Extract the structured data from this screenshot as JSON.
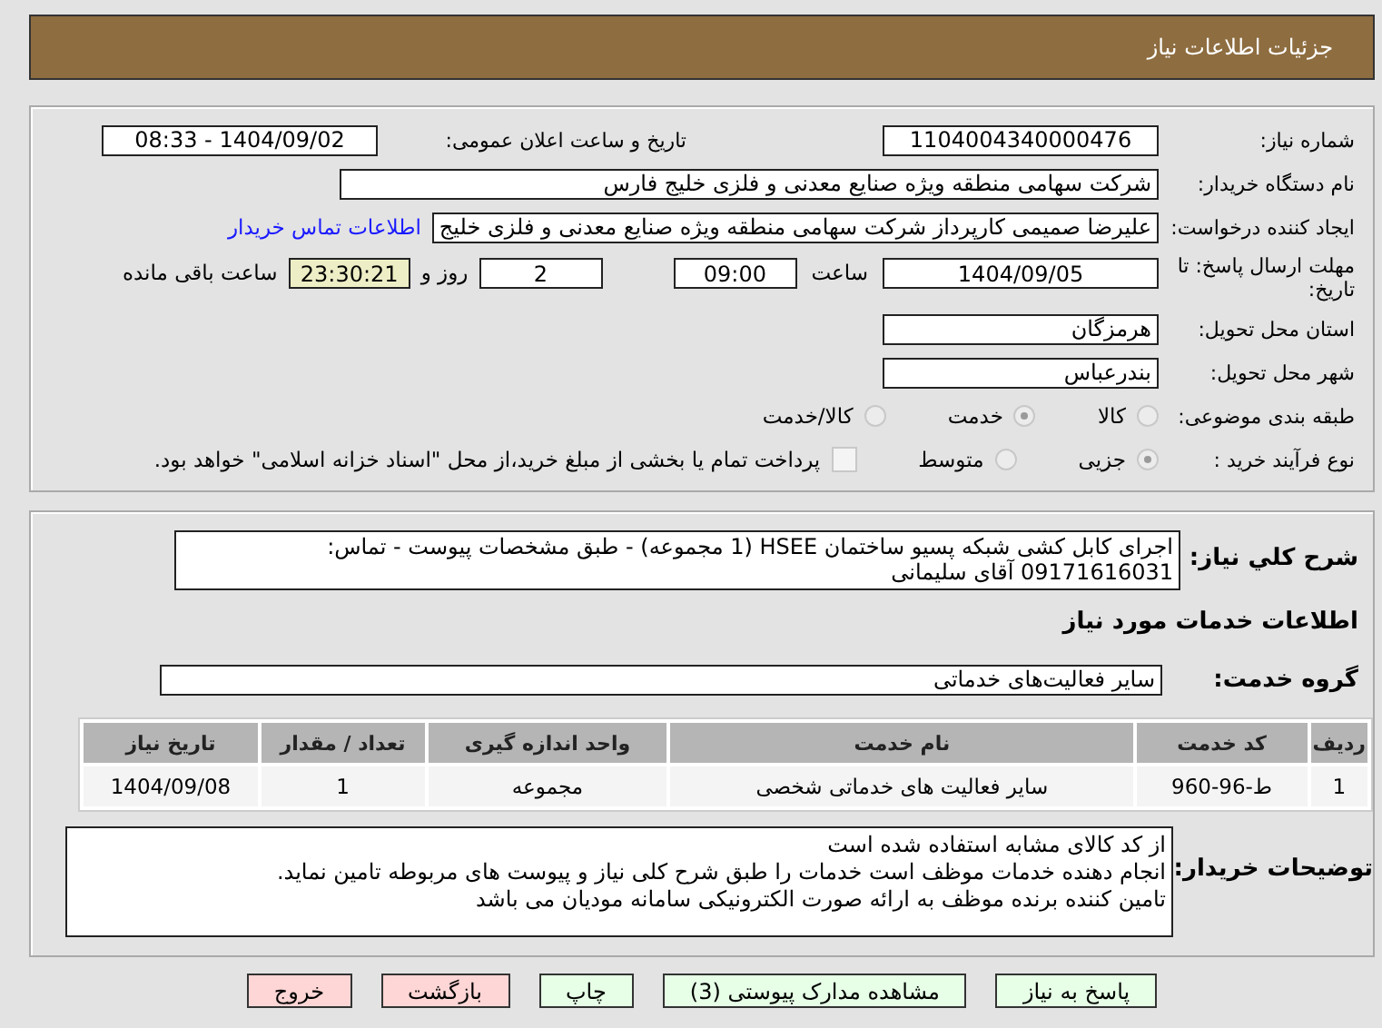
{
  "header": {
    "title": "جزئیات اطلاعات نیاز"
  },
  "fields": {
    "need_number": {
      "label": "شماره نیاز:",
      "value": "1104004340000476"
    },
    "announce": {
      "label": "تاریخ و ساعت اعلان عمومی:",
      "value": "1404/09/02 - 08:33"
    },
    "buyer": {
      "label": "نام دستگاه خریدار:",
      "value": "شرکت سهامی منطقه ویژه صنایع معدنی و فلزی خلیج فارس"
    },
    "creator": {
      "label": "ایجاد کننده درخواست:",
      "value": "علیرضا صمیمی کارپرداز شرکت سهامی منطقه ویژه صنایع معدنی و فلزی خلیج",
      "link": "اطلاعات تماس خریدار"
    },
    "deadline": {
      "label": "مهلت ارسال پاسخ: تا تاریخ:",
      "date": "1404/09/05",
      "time_label": "ساعت",
      "time": "09:00",
      "days": "2",
      "days_label": "روز و",
      "remaining": "23:30:21",
      "remaining_label": "ساعت باقی مانده"
    },
    "province": {
      "label": "استان محل تحویل:",
      "value": "هرمزگان"
    },
    "city": {
      "label": "شهر محل تحویل:",
      "value": "بندرعباس"
    },
    "category": {
      "label": "طبقه بندی موضوعی:",
      "options": [
        {
          "label": "کالا",
          "selected": false
        },
        {
          "label": "خدمت",
          "selected": true
        },
        {
          "label": "کالا/خدمت",
          "selected": false
        }
      ]
    },
    "process": {
      "label": "نوع فرآیند خرید :",
      "options": [
        {
          "label": "جزیی",
          "selected": true
        },
        {
          "label": "متوسط",
          "selected": false
        }
      ],
      "payment": {
        "checked": false,
        "label": "پرداخت تمام یا بخشی از مبلغ خرید،از محل \"اسناد خزانه اسلامی\" خواهد بود."
      }
    }
  },
  "description": {
    "label": "شرح کلي نياز:",
    "value": "اجرای کابل کشی شبکه پسیو ساختمان HSEE (1 مجموعه) - طبق مشخصات پیوست - تماس: 09171616031 آقای سلیمانی"
  },
  "services_heading": "اطلاعات خدمات مورد نیاز",
  "service_group": {
    "label": "گروه خدمت:",
    "value": "سایر فعالیت‌های خدماتی"
  },
  "table": {
    "columns": [
      "ردیف",
      "کد خدمت",
      "نام خدمت",
      "واحد اندازه گیری",
      "تعداد / مقدار",
      "تاریخ نیاز"
    ],
    "rows": [
      [
        "1",
        "ط-96-960",
        "سایر فعالیت های خدماتی شخصی",
        "مجموعه",
        "1",
        "1404/09/08"
      ]
    ]
  },
  "buyer_notes": {
    "label": "توضیحات خریدار:",
    "lines": [
      "از کد کالای مشابه استفاده شده است",
      "انجام دهنده خدمات موظف است خدمات را طبق شرح کلی نیاز و پیوست های مربوطه تامین نماید.",
      "تامین کننده برنده موظف به ارائه صورت الکترونیکی سامانه مودیان می باشد"
    ]
  },
  "buttons": [
    {
      "label": "پاسخ به نیاز",
      "kind": "green"
    },
    {
      "label": "مشاهده مدارک پیوستی (3)",
      "kind": "green"
    },
    {
      "label": "چاپ",
      "kind": "green"
    },
    {
      "label": "بازگشت",
      "kind": "red"
    },
    {
      "label": "خروج",
      "kind": "red"
    }
  ]
}
